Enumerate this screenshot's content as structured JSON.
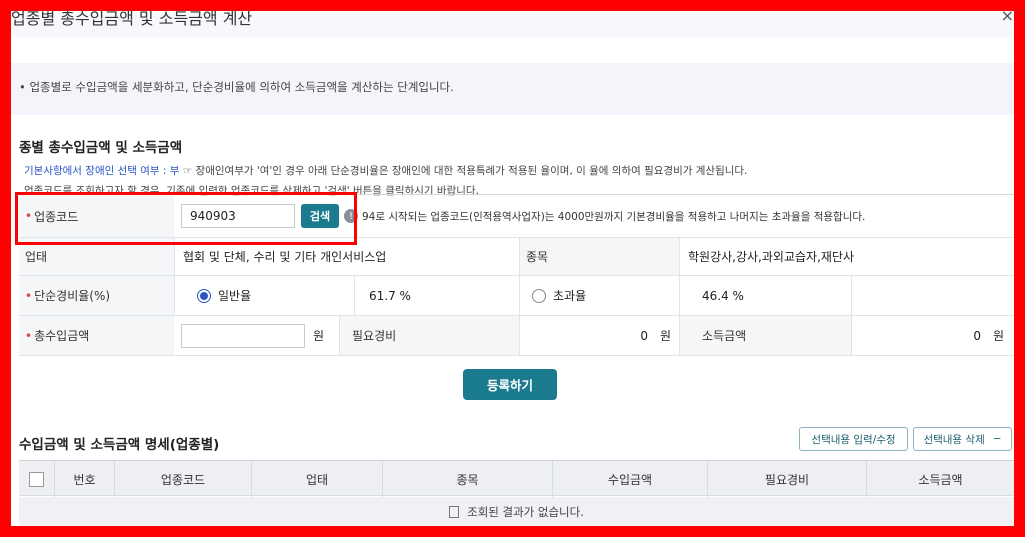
{
  "title": "업종별 총수입금액 및 소득금액 계산",
  "notice": "• 업종별로 수입금액을 세분화하고, 단순경비율에 의하여 소득금액을 계산하는 단계입니다.",
  "section1": {
    "title": "종별 총수입금액 및 소득금액",
    "info1_blue": "기본사항에서 장애인 선택 여부 : 부",
    "info1_rest": " ☞ 장애인여부가 '여'인 경우 아래 단순경비율은 장애인에 대한 적용특례가 적용된 율이며, 이 율에 의하여 필요경비가 계산됩니다.",
    "info2": "업종코드를 조회하고자 할 경우, 기존에 입력한 업종코드를 삭제하고 '검색' 버튼을 클릭하시기 바랍니다."
  },
  "form": {
    "code_label": "업종코드",
    "code_value": "940903",
    "search_button": "검색",
    "code_note": "94로 시작되는 업종코드(인적용역사업자)는 4000만원까지 기본경비율을 적용하고 나머지는 초과율을 적용합니다.",
    "business_type_label": "업태",
    "business_type_value": "협회 및 단체, 수리 및 기타 개인서비스업",
    "item_label": "종목",
    "item_value": "학원강사,강사,과외교습자,재단사",
    "rate_label": "단순경비율(%)",
    "general_rate_label": "일반율",
    "general_rate_value": "61.7 %",
    "excess_rate_label": "초과율",
    "excess_rate_value": "46.4 %",
    "revenue_label": "총수입금액",
    "revenue_value": "",
    "won": "원",
    "expense_label": "필요경비",
    "expense_value": "0",
    "income_label": "소득금액",
    "income_value": "0"
  },
  "register_button": "등록하기",
  "section2": {
    "title": "수입금액 및 소득금액 명세(업종별)",
    "edit_button": "선택내용 입력/수정",
    "delete_button": "선택내용 삭제",
    "delete_icon": "−",
    "columns": [
      "번호",
      "업종코드",
      "업태",
      "종목",
      "수입금액",
      "필요경비",
      "소득금액"
    ],
    "empty_message": "조회된 결과가 없습니다."
  },
  "close_icon": "×"
}
